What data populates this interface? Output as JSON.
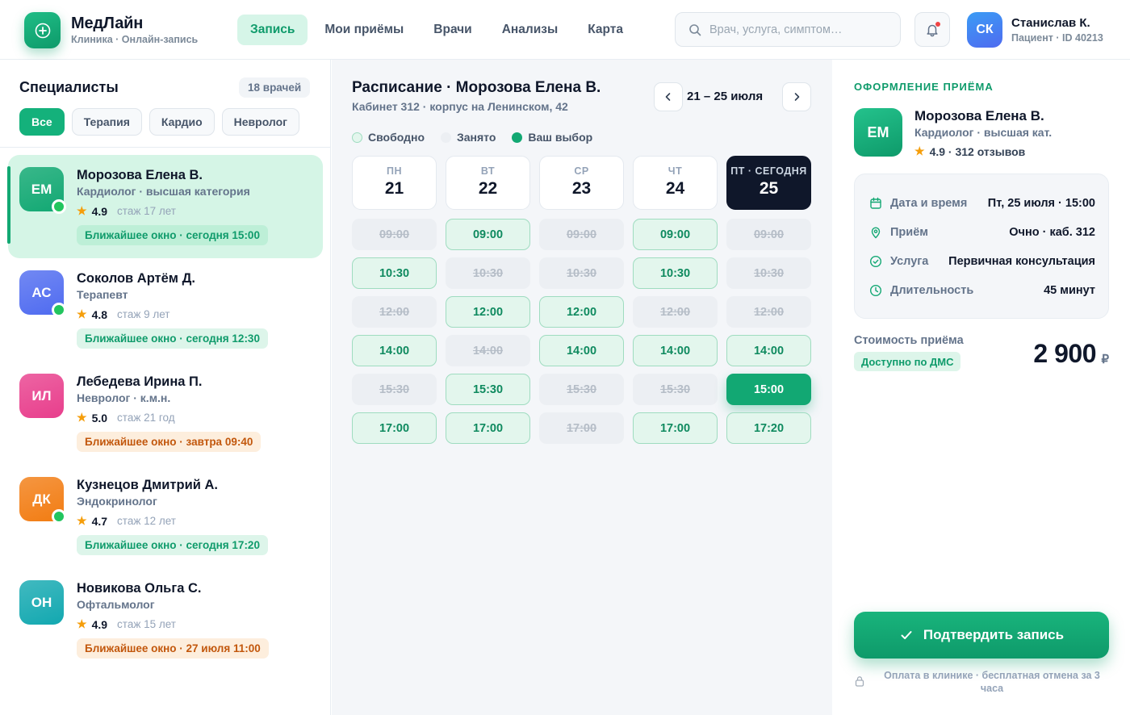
{
  "header": {
    "brand": "МедЛайн",
    "brand_sub": "Клиника · Онлайн-запись",
    "nav": [
      "Запись",
      "Мои приёмы",
      "Врачи",
      "Анализы",
      "Карта"
    ],
    "search_placeholder": "Врач, услуга, симптом…",
    "user": {
      "initials": "СК",
      "name": "Станислав К.",
      "sub": "Пациент · ID 40213"
    }
  },
  "specialists": {
    "title": "Специалисты",
    "count": "18 врачей",
    "filters": [
      "Все",
      "Терапия",
      "Кардио",
      "Невролог"
    ],
    "doctors": [
      {
        "initials": "ЕМ",
        "name": "Морозова Елена В.",
        "spec": "Кардиолог · высшая категория",
        "rating": "4.9",
        "exp": "стаж 17 лет",
        "slot": "Ближайшее окно · сегодня 15:00",
        "online": true,
        "slot_color": "green",
        "avatar_color": "#12a873"
      },
      {
        "initials": "АС",
        "name": "Соколов Артём Д.",
        "spec": "Терапевт",
        "rating": "4.8",
        "exp": "стаж 9 лет",
        "slot": "Ближайшее окно · сегодня 12:30",
        "online": true,
        "slot_color": "green",
        "avatar_color": "#4f6bf0"
      },
      {
        "initials": "ИЛ",
        "name": "Лебедева Ирина П.",
        "spec": "Невролог · к.м.н.",
        "rating": "5.0",
        "exp": "стаж 21 год",
        "slot": "Ближайшее окно · завтра 09:40",
        "online": false,
        "slot_color": "orange",
        "avatar_color": "#e83e8c"
      },
      {
        "initials": "ДК",
        "name": "Кузнецов Дмитрий А.",
        "spec": "Эндокринолог",
        "rating": "4.7",
        "exp": "стаж 12 лет",
        "slot": "Ближайшее окно · сегодня 17:20",
        "online": true,
        "slot_color": "green",
        "avatar_color": "#f27c12"
      },
      {
        "initials": "ОН",
        "name": "Новикова Ольга С.",
        "spec": "Офтальмолог",
        "rating": "4.9",
        "exp": "стаж 15 лет",
        "slot": "Ближайшее окно · 27 июля 11:00",
        "online": false,
        "slot_color": "orange",
        "avatar_color": "#12a8b0"
      }
    ]
  },
  "schedule": {
    "title": "Расписание · Морозова Елена В.",
    "sub": "Кабинет 312 · корпус на Ленинском, 42",
    "week_range": "21 – 25 июля",
    "legend": [
      "Свободно",
      "Занято",
      "Ваш выбор"
    ],
    "days": [
      {
        "dow": "ПН",
        "num": "21",
        "today": false
      },
      {
        "dow": "ВТ",
        "num": "22",
        "today": false
      },
      {
        "dow": "СР",
        "num": "23",
        "today": false
      },
      {
        "dow": "ЧТ",
        "num": "24",
        "today": false
      },
      {
        "dow": "ПТ · СЕГОДНЯ",
        "num": "25",
        "today": true
      }
    ],
    "slots": [
      [
        {
          "t": "09:00",
          "s": "busy"
        },
        {
          "t": "10:30",
          "s": "free"
        },
        {
          "t": "12:00",
          "s": "busy"
        },
        {
          "t": "14:00",
          "s": "free"
        },
        {
          "t": "15:30",
          "s": "busy"
        },
        {
          "t": "17:00",
          "s": "free"
        }
      ],
      [
        {
          "t": "09:00",
          "s": "free"
        },
        {
          "t": "10:30",
          "s": "busy"
        },
        {
          "t": "12:00",
          "s": "free"
        },
        {
          "t": "14:00",
          "s": "busy"
        },
        {
          "t": "15:30",
          "s": "free"
        },
        {
          "t": "17:00",
          "s": "free"
        }
      ],
      [
        {
          "t": "09:00",
          "s": "busy"
        },
        {
          "t": "10:30",
          "s": "busy"
        },
        {
          "t": "12:00",
          "s": "free"
        },
        {
          "t": "14:00",
          "s": "free"
        },
        {
          "t": "15:30",
          "s": "busy"
        },
        {
          "t": "17:00",
          "s": "busy"
        }
      ],
      [
        {
          "t": "09:00",
          "s": "free"
        },
        {
          "t": "10:30",
          "s": "free"
        },
        {
          "t": "12:00",
          "s": "busy"
        },
        {
          "t": "14:00",
          "s": "free"
        },
        {
          "t": "15:30",
          "s": "busy"
        },
        {
          "t": "17:00",
          "s": "free"
        }
      ],
      [
        {
          "t": "09:00",
          "s": "busy"
        },
        {
          "t": "10:30",
          "s": "busy"
        },
        {
          "t": "12:00",
          "s": "busy"
        },
        {
          "t": "14:00",
          "s": "free"
        },
        {
          "t": "15:00",
          "s": "selected"
        },
        {
          "t": "17:20",
          "s": "free"
        }
      ]
    ]
  },
  "booking": {
    "label": "ОФОРМЛЕНИЕ ПРИЁМА",
    "initials": "ЕМ",
    "name": "Морозова Елена В.",
    "spec": "Кардиолог · высшая кат.",
    "rating": "4.9 · 312 отзывов",
    "details": [
      {
        "icon": "calendar-icon",
        "label": "Дата и время",
        "value": "Пт, 25 июля · 15:00"
      },
      {
        "icon": "location-pin-icon",
        "label": "Приём",
        "value": "Очно · каб. 312"
      },
      {
        "icon": "check-circle-icon",
        "label": "Услуга",
        "value": "Первичная консультация"
      },
      {
        "icon": "clock-icon",
        "label": "Длительность",
        "value": "45 минут"
      }
    ],
    "cost_label": "Стоимость приёма",
    "dms": "Доступно по ДМС",
    "price": "2 900",
    "currency": "₽",
    "confirm": "Подтвердить запись",
    "footnote": "Оплата в клинике · бесплатная отмена за 3 часа"
  }
}
